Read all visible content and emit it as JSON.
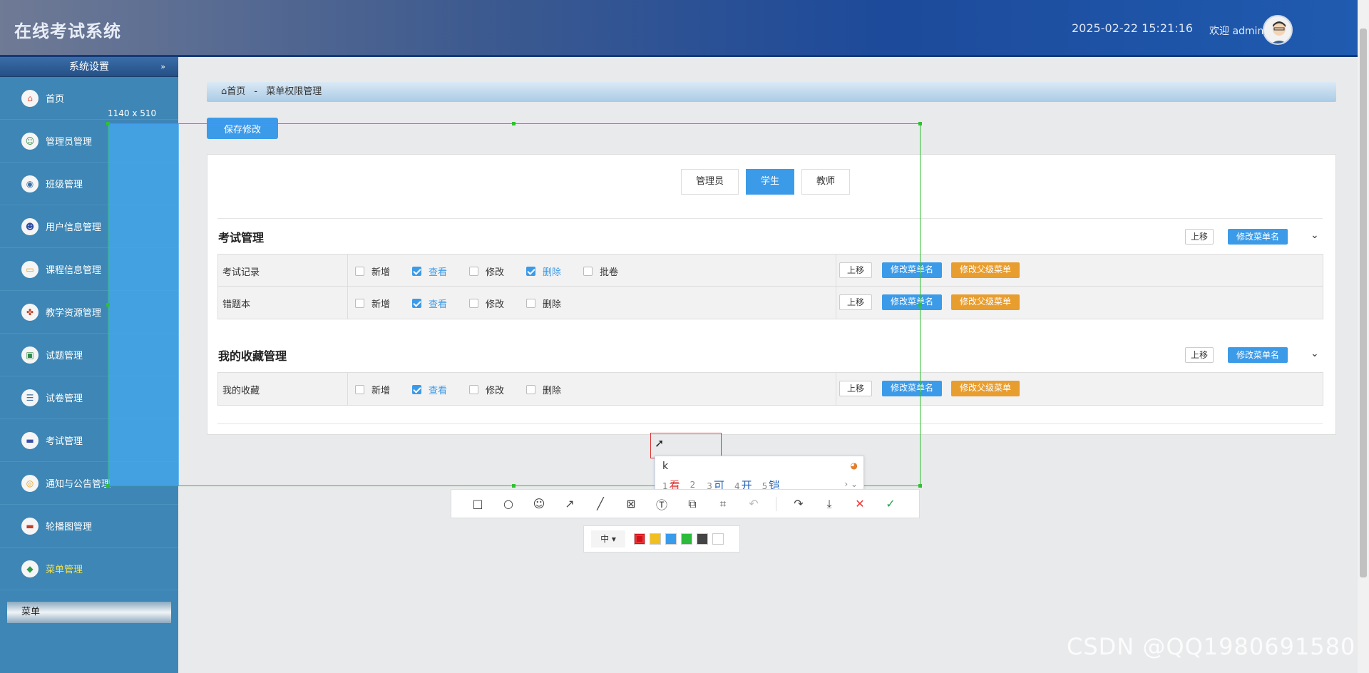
{
  "header": {
    "app_title": "在线考试系统",
    "datetime": "2025-02-22 15:21:16",
    "welcome": "欢迎 admin"
  },
  "sidebar": {
    "section_title": "系统设置",
    "items": [
      {
        "label": "首页",
        "icon": "home-icon"
      },
      {
        "label": "管理员管理",
        "icon": "admin-icon"
      },
      {
        "label": "班级管理",
        "icon": "class-icon"
      },
      {
        "label": "用户信息管理",
        "icon": "user-icon"
      },
      {
        "label": "课程信息管理",
        "icon": "course-icon"
      },
      {
        "label": "教学资源管理",
        "icon": "resource-icon"
      },
      {
        "label": "试题管理",
        "icon": "question-icon"
      },
      {
        "label": "试卷管理",
        "icon": "paper-icon"
      },
      {
        "label": "考试管理",
        "icon": "exam-icon"
      },
      {
        "label": "通知与公告管理",
        "icon": "notice-icon"
      },
      {
        "label": "轮播图管理",
        "icon": "carousel-icon"
      },
      {
        "label": "菜单管理",
        "icon": "menu-icon",
        "active": true
      }
    ],
    "bottom_label": "菜单"
  },
  "breadcrumb": {
    "home": "首页",
    "separator": "-",
    "current": "菜单权限管理"
  },
  "save_button": "保存修改",
  "role_tabs": [
    "管理员",
    "学生",
    "教师"
  ],
  "groups": [
    {
      "title": "考试管理",
      "up_label": "上移",
      "rename_label": "修改菜单名",
      "rows": [
        {
          "name": "考试记录",
          "perms": [
            {
              "label": "新增",
              "checked": false
            },
            {
              "label": "查看",
              "checked": true
            },
            {
              "label": "修改",
              "checked": false
            },
            {
              "label": "删除",
              "checked": true
            },
            {
              "label": "批卷",
              "checked": false
            }
          ],
          "up": "上移",
          "rename": "修改菜单名",
          "parent": "修改父级菜单"
        },
        {
          "name": "错题本",
          "perms": [
            {
              "label": "新增",
              "checked": false
            },
            {
              "label": "查看",
              "checked": true
            },
            {
              "label": "修改",
              "checked": false
            },
            {
              "label": "删除",
              "checked": false
            }
          ],
          "up": "上移",
          "rename": "修改菜单名",
          "parent": "修改父级菜单"
        }
      ]
    },
    {
      "title": "我的收藏管理",
      "up_label": "上移",
      "rename_label": "修改菜单名",
      "rows": [
        {
          "name": "我的收藏",
          "perms": [
            {
              "label": "新增",
              "checked": false
            },
            {
              "label": "查看",
              "checked": true
            },
            {
              "label": "修改",
              "checked": false
            },
            {
              "label": "删除",
              "checked": false
            }
          ],
          "up": "上移",
          "rename": "修改菜单名",
          "parent": "修改父级菜单"
        }
      ]
    }
  ],
  "snip": {
    "size_label": "1140 x 510",
    "ime_input": "k",
    "ime_candidates": [
      {
        "num": "1",
        "text": "看"
      },
      {
        "num": "2",
        "text": ""
      },
      {
        "num": "3",
        "text": "可"
      },
      {
        "num": "4",
        "text": "开"
      },
      {
        "num": "5",
        "text": "铠"
      }
    ],
    "ime_nav": "› ⌄",
    "size_select": "中 ▾",
    "toolbar_icons": [
      "rectangle-icon",
      "ellipse-icon",
      "emoji-icon",
      "arrow-icon",
      "line-icon",
      "mosaic-icon",
      "text-icon",
      "pin-icon",
      "ocr-icon",
      "undo-icon",
      "share-icon",
      "download-icon",
      "cancel-icon",
      "confirm-icon"
    ],
    "colors": [
      "#d0121b",
      "#f0c020",
      "#3a9bea",
      "#2cbb3a",
      "#444444",
      "#ffffff"
    ]
  },
  "watermark": "CSDN @QQ1980691580"
}
